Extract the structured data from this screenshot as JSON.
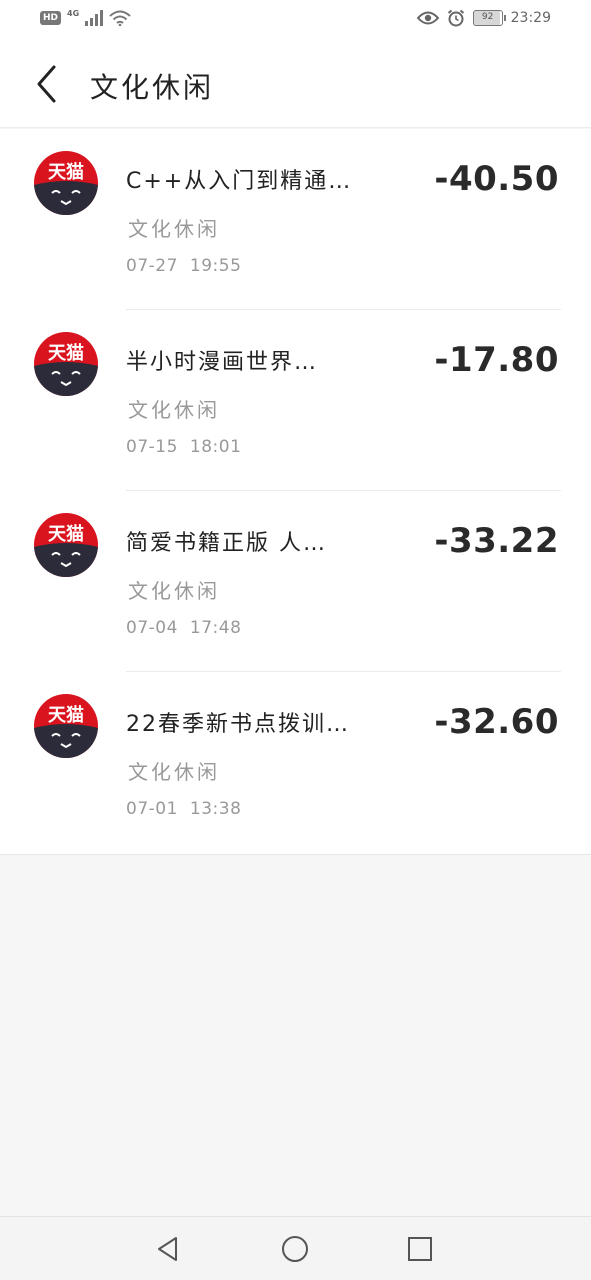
{
  "status_bar": {
    "hd": "HD",
    "network": "4G",
    "battery": "92",
    "time": "23:29"
  },
  "header": {
    "title": "文化休闲"
  },
  "transactions": [
    {
      "merchant_logo_text": "天猫",
      "title": "C++从入门到精通…",
      "category": "文化休闲",
      "date": "07-27",
      "time": "19:55",
      "amount": "-40.50"
    },
    {
      "merchant_logo_text": "天猫",
      "title": "半小时漫画世界…",
      "category": "文化休闲",
      "date": "07-15",
      "time": "18:01",
      "amount": "-17.80"
    },
    {
      "merchant_logo_text": "天猫",
      "title": "简爱书籍正版  人…",
      "category": "文化休闲",
      "date": "07-04",
      "time": "17:48",
      "amount": "-33.22"
    },
    {
      "merchant_logo_text": "天猫",
      "title": "22春季新书点拨训…",
      "category": "文化休闲",
      "date": "07-01",
      "time": "13:38",
      "amount": "-32.60"
    }
  ],
  "colors": {
    "tmall_red": "#d9141e",
    "tmall_dark": "#2b2b3a"
  }
}
